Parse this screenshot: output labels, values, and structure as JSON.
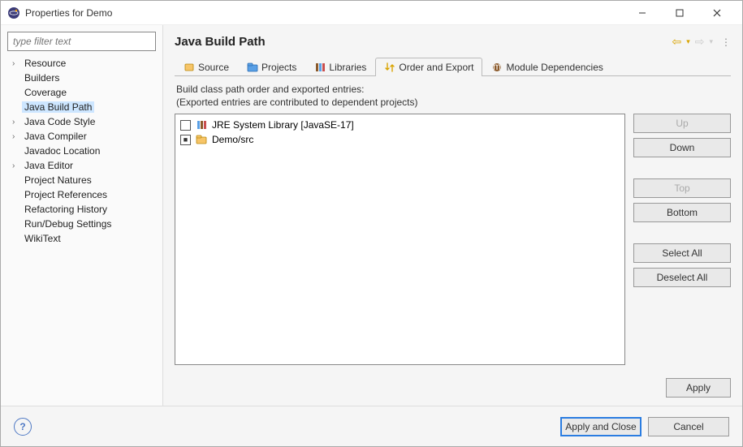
{
  "window": {
    "title": "Properties for Demo"
  },
  "sidebar": {
    "filter_placeholder": "type filter text",
    "items": [
      {
        "label": "Resource",
        "expandable": true,
        "selected": false
      },
      {
        "label": "Builders",
        "expandable": false,
        "selected": false
      },
      {
        "label": "Coverage",
        "expandable": false,
        "selected": false
      },
      {
        "label": "Java Build Path",
        "expandable": false,
        "selected": true
      },
      {
        "label": "Java Code Style",
        "expandable": true,
        "selected": false
      },
      {
        "label": "Java Compiler",
        "expandable": true,
        "selected": false
      },
      {
        "label": "Javadoc Location",
        "expandable": false,
        "selected": false
      },
      {
        "label": "Java Editor",
        "expandable": true,
        "selected": false
      },
      {
        "label": "Project Natures",
        "expandable": false,
        "selected": false
      },
      {
        "label": "Project References",
        "expandable": false,
        "selected": false
      },
      {
        "label": "Refactoring History",
        "expandable": false,
        "selected": false
      },
      {
        "label": "Run/Debug Settings",
        "expandable": false,
        "selected": false
      },
      {
        "label": "WikiText",
        "expandable": false,
        "selected": false
      }
    ]
  },
  "header": {
    "title": "Java Build Path"
  },
  "tabs": [
    {
      "label": "Source",
      "icon": "source-icon",
      "active": false
    },
    {
      "label": "Projects",
      "icon": "projects-icon",
      "active": false
    },
    {
      "label": "Libraries",
      "icon": "libraries-icon",
      "active": false
    },
    {
      "label": "Order and Export",
      "icon": "order-icon",
      "active": true
    },
    {
      "label": "Module Dependencies",
      "icon": "module-icon",
      "active": false
    }
  ],
  "description": {
    "line1": "Build class path order and exported entries:",
    "line2": "(Exported entries are contributed to dependent projects)"
  },
  "list": [
    {
      "label": "JRE System Library [JavaSE-17]",
      "checked": false,
      "icon": "library-icon"
    },
    {
      "label": "Demo/src",
      "checked": true,
      "icon": "folder-icon"
    }
  ],
  "side_buttons": {
    "up": "Up",
    "up_disabled": true,
    "down": "Down",
    "down_disabled": false,
    "top": "Top",
    "top_disabled": true,
    "bottom": "Bottom",
    "bottom_disabled": false,
    "select_all": "Select All",
    "deselect_all": "Deselect All"
  },
  "footer": {
    "apply": "Apply",
    "apply_close": "Apply and Close",
    "cancel": "Cancel"
  }
}
